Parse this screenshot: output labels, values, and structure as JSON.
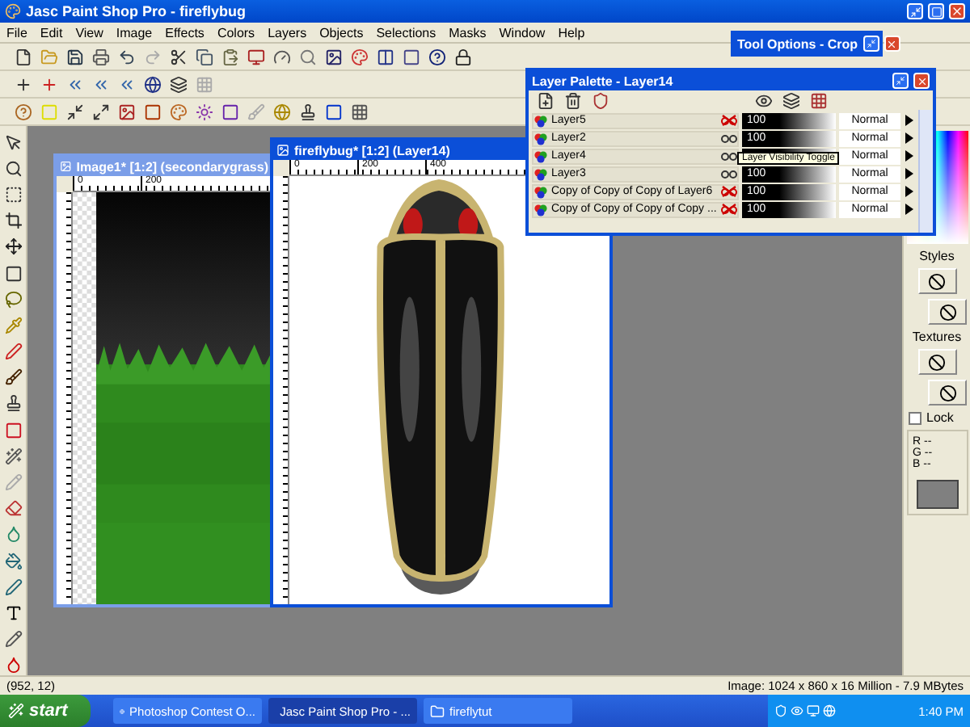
{
  "window": {
    "title": "Jasc Paint Shop Pro - fireflybug"
  },
  "menu": [
    "File",
    "Edit",
    "View",
    "Image",
    "Effects",
    "Colors",
    "Layers",
    "Objects",
    "Selections",
    "Masks",
    "Window",
    "Help"
  ],
  "tool_options": {
    "title": "Tool Options - Crop"
  },
  "layer_palette": {
    "title": "Layer Palette - Layer14",
    "tooltip": "Layer Visibility Toggle",
    "layers": [
      {
        "name": "Layer5",
        "visible": false,
        "opacity": "100",
        "blend": "Normal"
      },
      {
        "name": "Layer2",
        "visible": true,
        "opacity": "100",
        "blend": "Normal"
      },
      {
        "name": "Layer4",
        "visible": true,
        "blend": "Normal"
      },
      {
        "name": "Layer3",
        "visible": true,
        "opacity": "100",
        "blend": "Normal"
      },
      {
        "name": "Copy of Copy of Copy of Layer6",
        "visible": false,
        "opacity": "100",
        "blend": "Normal"
      },
      {
        "name": "Copy of Copy of Copy of Copy ...",
        "visible": false,
        "opacity": "100",
        "blend": "Normal"
      }
    ]
  },
  "documents": [
    {
      "kind": "grass",
      "title": "Image1* [1:2] (secondarygrass)",
      "active": false,
      "ruler_labels": [
        "0",
        "200"
      ]
    },
    {
      "kind": "firefly",
      "title": "fireflybug* [1:2] (Layer14)",
      "active": true,
      "ruler_labels": [
        "0",
        "200",
        "400"
      ]
    }
  ],
  "side_panel": {
    "styles_label": "Styles",
    "textures_label": "Textures",
    "lock": {
      "label": "Lock",
      "checked": false
    },
    "channels": [
      {
        "name": "R",
        "value": "--"
      },
      {
        "name": "G",
        "value": "--"
      },
      {
        "name": "B",
        "value": "--"
      }
    ]
  },
  "status_bar": {
    "position": "(952, 12)",
    "image_info": "Image: 1024 x 860 x 16 Million - 7.9 MBytes"
  },
  "taskbar": {
    "start": "start",
    "tasks": [
      {
        "label": "Photoshop Contest O...",
        "selected": false
      },
      {
        "label": "Jasc Paint Shop Pro - ...",
        "selected": true
      },
      {
        "label": "fireflytut",
        "selected": false
      }
    ],
    "clock": "1:40 PM"
  }
}
